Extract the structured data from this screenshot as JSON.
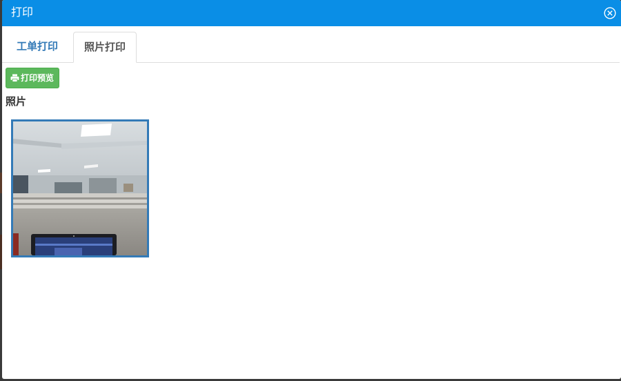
{
  "dialog": {
    "title": "打印",
    "close_icon": "close-circle-icon",
    "header_color": "#0a8ee6"
  },
  "tabs": [
    {
      "label": "工单打印",
      "active": false
    },
    {
      "label": "照片打印",
      "active": true
    }
  ],
  "toolbar": {
    "preview_label": "打印预览",
    "preview_icon": "printer-icon",
    "preview_color": "#5cb85c"
  },
  "photos": {
    "section_label": "照片",
    "items": [
      {
        "description": "office-interior-photo",
        "selected": true,
        "border_color": "#337ab7"
      }
    ]
  }
}
